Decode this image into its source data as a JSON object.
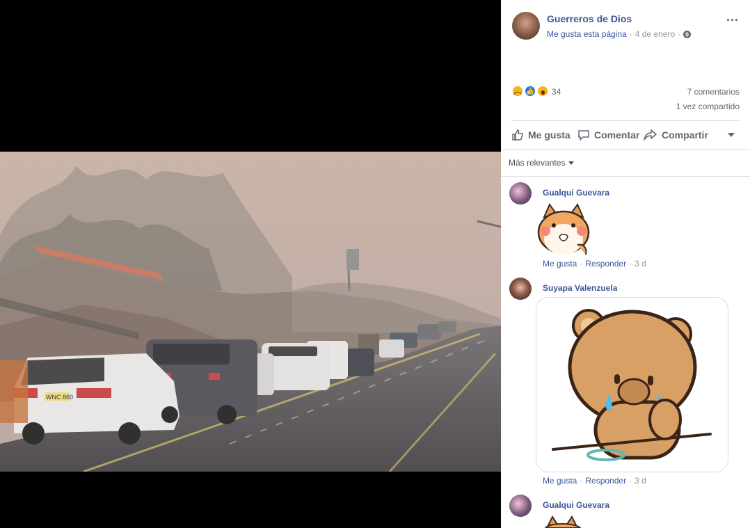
{
  "post": {
    "page_name": "Guerreros de Dios",
    "like_page": "Me gusta esta página",
    "sep": "·",
    "date": "4 de enero",
    "reactions_count": "34",
    "comments_count": "7 comentarios",
    "shares_count": "1 vez compartido",
    "actions": {
      "like": "Me gusta",
      "comment": "Comentar",
      "share": "Compartir"
    },
    "more_menu": "...",
    "sort_label": "Más relevantes"
  },
  "comments": [
    {
      "author": "Gualqui Guevara",
      "like": "Me gusta",
      "reply": "Responder",
      "time": "3 d",
      "sep": "·"
    },
    {
      "author": "Suyapa Valenzuela",
      "like": "Me gusta",
      "reply": "Responder",
      "time": "3 d",
      "sep": "·"
    },
    {
      "author": "Gualqui Guevara"
    }
  ],
  "photo_plate": "WNC 860",
  "colors": {
    "link": "#385898",
    "meta": "#90949c",
    "like_blue": "#1877f2",
    "haha_yellow": "#f7b125"
  }
}
